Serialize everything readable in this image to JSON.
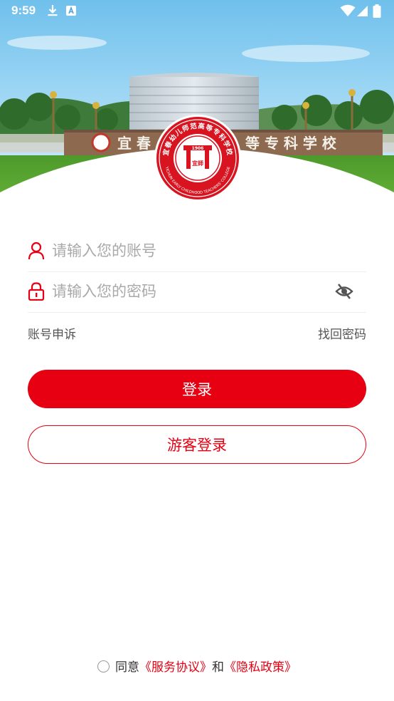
{
  "status_bar": {
    "time": "9:59",
    "icons": [
      "download-icon",
      "a-notification-icon",
      "wifi-icon",
      "signal-icon",
      "battery-icon"
    ]
  },
  "hero": {
    "gate_text_left": "宜 春",
    "gate_text_right": "等 专 科 学 校",
    "emblem": {
      "arc_text": "宜春幼儿师范高等专科学校",
      "year": "1906",
      "seal_char": "宜師",
      "english": "YICHUN EARLY CHILDHOOD TEACHERS' COLLEGE"
    }
  },
  "form": {
    "account_placeholder": "请输入您的账号",
    "password_placeholder": "请输入您的密码",
    "account_appeal": "账号申诉",
    "forgot_password": "找回密码",
    "login_button": "登录",
    "guest_login_button": "游客登录"
  },
  "agreement": {
    "prefix": "同意",
    "service": "《服务协议》",
    "and": "和",
    "privacy": "《隐私政策》"
  },
  "colors": {
    "primary_red": "#e60012",
    "placeholder": "#a9a9a9",
    "divider": "#eeeeee"
  }
}
